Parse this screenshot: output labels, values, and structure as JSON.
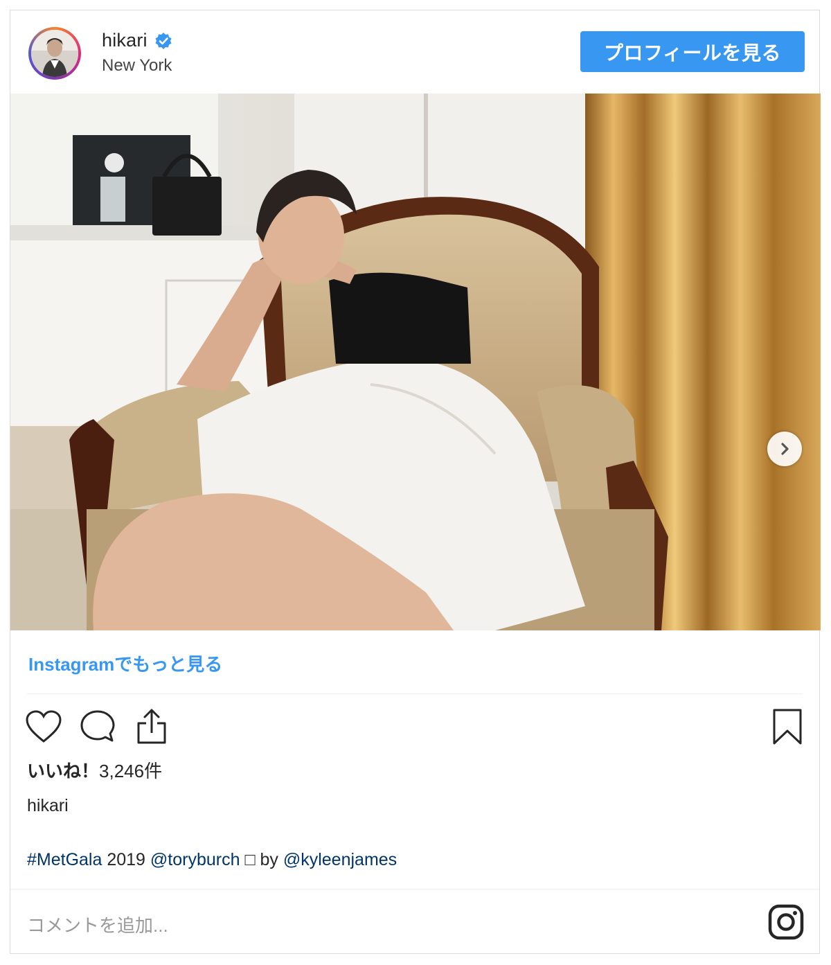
{
  "header": {
    "username": "hikari",
    "location": "New York",
    "profile_button": "プロフィールを見る"
  },
  "post": {
    "more_link": "Instagramでもっと見る",
    "likes_label": "いいね！",
    "likes_count": "3,246件",
    "caption_user": "hikari",
    "caption": {
      "hashtag": "#MetGala",
      "year": " 2019 ",
      "mention1": "@toryburch",
      "middle": " □ by ",
      "mention2": "@kyleenjames"
    },
    "comment_placeholder": "コメントを追加..."
  },
  "colors": {
    "accent": "#3897f0",
    "link": "#003569",
    "text": "#262626",
    "muted": "#999999"
  },
  "icons": [
    "verified-badge-icon",
    "heart-icon",
    "comment-icon",
    "share-icon",
    "bookmark-icon",
    "chevron-right-icon",
    "instagram-logo-icon"
  ]
}
